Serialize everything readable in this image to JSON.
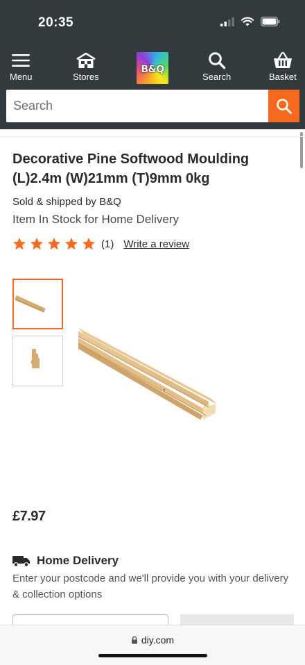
{
  "status_bar": {
    "time": "20:35"
  },
  "nav": {
    "menu_label": "Menu",
    "stores_label": "Stores",
    "logo_text": "B&Q",
    "search_label": "Search",
    "basket_label": "Basket"
  },
  "search": {
    "placeholder": "Search"
  },
  "product": {
    "title": "Decorative Pine Softwood Moulding (L)2.4m (W)21mm (T)9mm 0kg",
    "sold_by": "Sold & shipped by B&Q",
    "stock_status": "Item In Stock for Home Delivery",
    "rating_stars": 5,
    "review_count": "(1)",
    "write_review_label": "Write a review",
    "price": "£7.97"
  },
  "delivery": {
    "title": "Home Delivery",
    "description": "Enter your postcode and we'll provide you with your delivery & collection options"
  },
  "browser": {
    "url": "diy.com"
  },
  "colors": {
    "accent": "#f7691e",
    "header_bg": "#333a3d",
    "star": "#f7691e"
  }
}
